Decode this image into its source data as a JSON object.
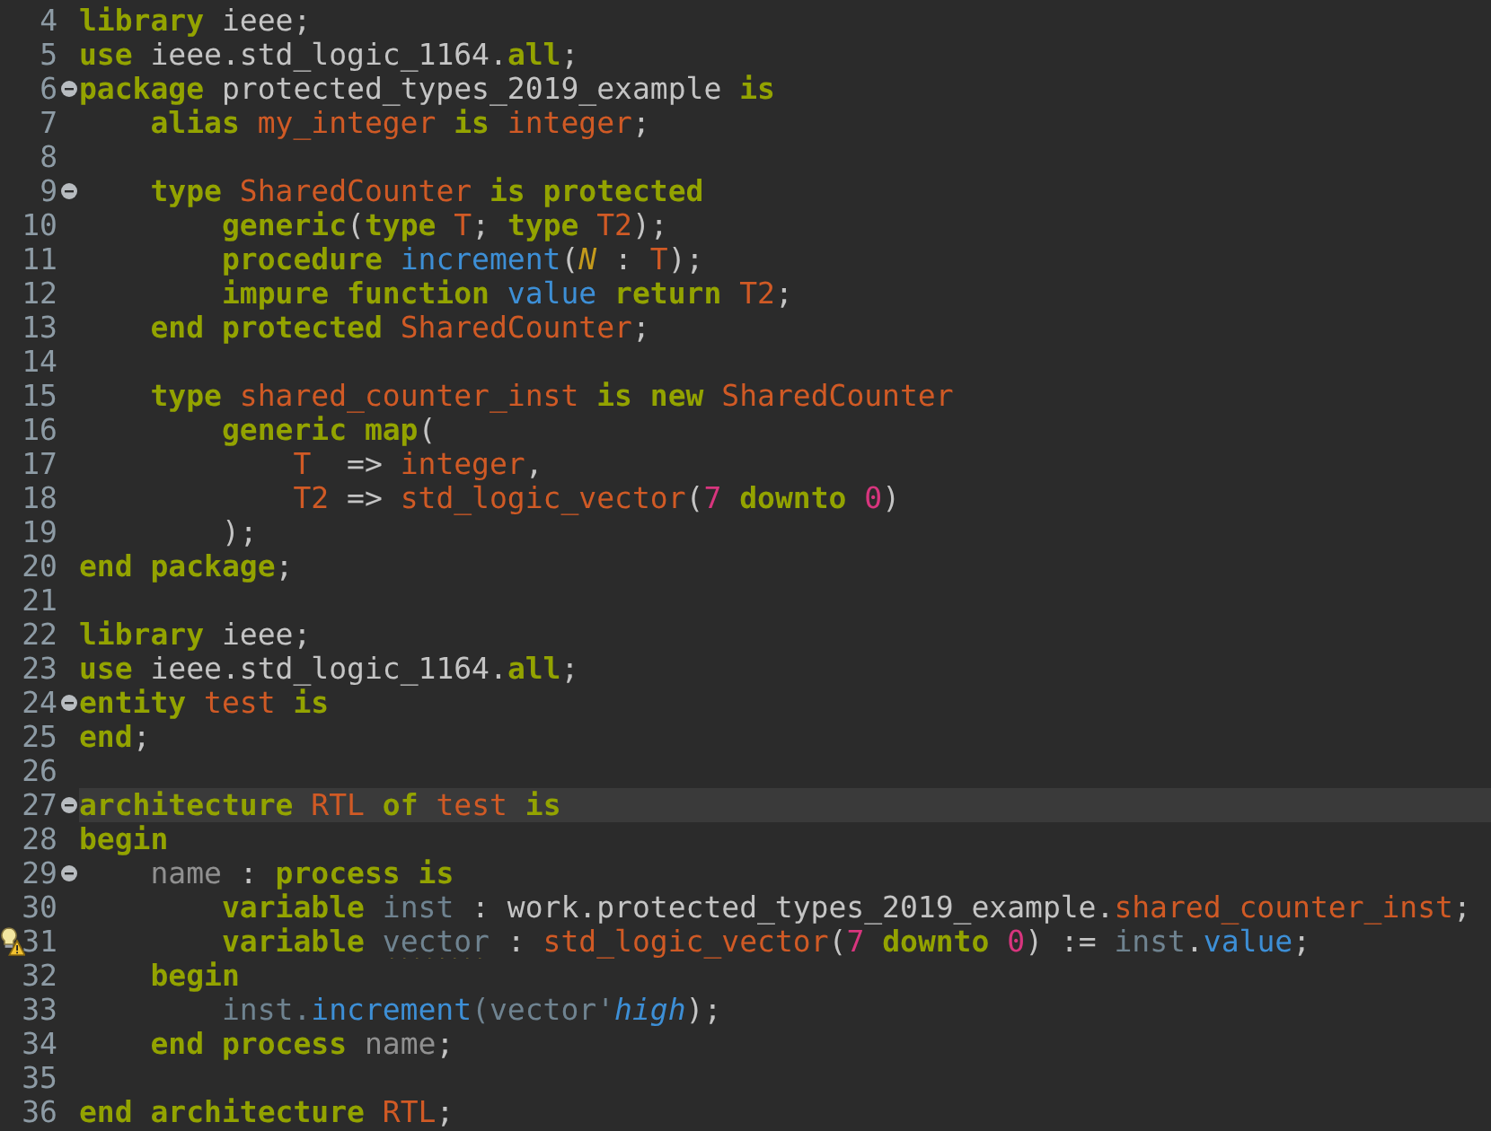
{
  "editor": {
    "lines": [
      {
        "number": "4",
        "fold": false,
        "current": false,
        "warning": false,
        "tokens": [
          {
            "kind": "kw",
            "text": "library"
          },
          {
            "kind": "txt",
            "text": " ieee;"
          }
        ]
      },
      {
        "number": "5",
        "fold": false,
        "current": false,
        "warning": false,
        "tokens": [
          {
            "kind": "kw",
            "text": "use"
          },
          {
            "kind": "txt",
            "text": " ieee.std_logic_1164."
          },
          {
            "kind": "kw",
            "text": "all"
          },
          {
            "kind": "txt",
            "text": ";"
          }
        ]
      },
      {
        "number": "6",
        "fold": true,
        "current": false,
        "warning": false,
        "tokens": [
          {
            "kind": "kw",
            "text": "package"
          },
          {
            "kind": "txt",
            "text": " protected_types_2019_example "
          },
          {
            "kind": "kw",
            "text": "is"
          }
        ]
      },
      {
        "number": "7",
        "fold": false,
        "current": false,
        "warning": false,
        "tokens": [
          {
            "kind": "kw",
            "text": "    alias"
          },
          {
            "kind": "id",
            "text": " my_integer"
          },
          {
            "kind": "kw",
            "text": " is"
          },
          {
            "kind": "id",
            "text": " integer"
          },
          {
            "kind": "txt",
            "text": ";"
          }
        ]
      },
      {
        "number": "8",
        "fold": false,
        "current": false,
        "warning": false
      },
      {
        "number": "9",
        "fold": true,
        "current": false,
        "warning": false,
        "tokens": [
          {
            "kind": "kw",
            "text": "    type"
          },
          {
            "kind": "id",
            "text": " SharedCounter"
          },
          {
            "kind": "kw",
            "text": " is protected"
          }
        ]
      },
      {
        "number": "10",
        "fold": false,
        "current": false,
        "warning": false,
        "tokens": [
          {
            "kind": "kw",
            "text": "        generic"
          },
          {
            "kind": "txt",
            "text": "("
          },
          {
            "kind": "kw",
            "text": "type"
          },
          {
            "kind": "id",
            "text": " T"
          },
          {
            "kind": "txt",
            "text": ";"
          },
          {
            "kind": "kw",
            "text": " type"
          },
          {
            "kind": "id",
            "text": " T2"
          },
          {
            "kind": "txt",
            "text": ");"
          }
        ]
      },
      {
        "number": "11",
        "fold": false,
        "current": false,
        "warning": false,
        "tokens": [
          {
            "kind": "kw",
            "text": "        procedure"
          },
          {
            "kind": "fn",
            "text": " increment"
          },
          {
            "kind": "txt",
            "text": "("
          },
          {
            "kind": "param",
            "text": "N"
          },
          {
            "kind": "txt",
            "text": " :"
          },
          {
            "kind": "id",
            "text": " T"
          },
          {
            "kind": "txt",
            "text": ");"
          }
        ]
      },
      {
        "number": "12",
        "fold": false,
        "current": false,
        "warning": false,
        "tokens": [
          {
            "kind": "kw",
            "text": "        impure function"
          },
          {
            "kind": "fn",
            "text": " value"
          },
          {
            "kind": "kw",
            "text": " return"
          },
          {
            "kind": "id",
            "text": " T2"
          },
          {
            "kind": "txt",
            "text": ";"
          }
        ]
      },
      {
        "number": "13",
        "fold": false,
        "current": false,
        "warning": false,
        "tokens": [
          {
            "kind": "kw",
            "text": "    end protected"
          },
          {
            "kind": "id",
            "text": " SharedCounter"
          },
          {
            "kind": "txt",
            "text": ";"
          }
        ]
      },
      {
        "number": "14",
        "fold": false,
        "current": false,
        "warning": false
      },
      {
        "number": "15",
        "fold": false,
        "current": false,
        "warning": false,
        "tokens": [
          {
            "kind": "kw",
            "text": "    type"
          },
          {
            "kind": "id",
            "text": " shared_counter_inst"
          },
          {
            "kind": "kw",
            "text": " is new"
          },
          {
            "kind": "id",
            "text": " SharedCounter"
          }
        ]
      },
      {
        "number": "16",
        "fold": false,
        "current": false,
        "warning": false,
        "tokens": [
          {
            "kind": "kw",
            "text": "        generic map"
          },
          {
            "kind": "txt",
            "text": "("
          }
        ]
      },
      {
        "number": "17",
        "fold": false,
        "current": false,
        "warning": false,
        "tokens": [
          {
            "kind": "id",
            "text": "            T"
          },
          {
            "kind": "txt",
            "text": "  =>"
          },
          {
            "kind": "id",
            "text": " integer"
          },
          {
            "kind": "txt",
            "text": ","
          }
        ]
      },
      {
        "number": "18",
        "fold": false,
        "current": false,
        "warning": false,
        "tokens": [
          {
            "kind": "id",
            "text": "            T2"
          },
          {
            "kind": "txt",
            "text": " =>"
          },
          {
            "kind": "id",
            "text": " std_logic_vector"
          },
          {
            "kind": "txt",
            "text": "("
          },
          {
            "kind": "num",
            "text": "7"
          },
          {
            "kind": "kw",
            "text": " downto"
          },
          {
            "kind": "num",
            "text": " 0"
          },
          {
            "kind": "txt",
            "text": ")"
          }
        ]
      },
      {
        "number": "19",
        "fold": false,
        "current": false,
        "warning": false,
        "tokens": [
          {
            "kind": "txt",
            "text": "        );"
          }
        ]
      },
      {
        "number": "20",
        "fold": false,
        "current": false,
        "warning": false,
        "tokens": [
          {
            "kind": "kw",
            "text": "end package"
          },
          {
            "kind": "txt",
            "text": ";"
          }
        ]
      },
      {
        "number": "21",
        "fold": false,
        "current": false,
        "warning": false
      },
      {
        "number": "22",
        "fold": false,
        "current": false,
        "warning": false,
        "tokens": [
          {
            "kind": "kw",
            "text": "library"
          },
          {
            "kind": "txt",
            "text": " ieee;"
          }
        ]
      },
      {
        "number": "23",
        "fold": false,
        "current": false,
        "warning": false,
        "tokens": [
          {
            "kind": "kw",
            "text": "use"
          },
          {
            "kind": "txt",
            "text": " ieee.std_logic_1164."
          },
          {
            "kind": "kw",
            "text": "all"
          },
          {
            "kind": "txt",
            "text": ";"
          }
        ]
      },
      {
        "number": "24",
        "fold": true,
        "current": false,
        "warning": false,
        "tokens": [
          {
            "kind": "kw",
            "text": "entity"
          },
          {
            "kind": "id",
            "text": " test"
          },
          {
            "kind": "kw",
            "text": " is"
          }
        ]
      },
      {
        "number": "25",
        "fold": false,
        "current": false,
        "warning": false,
        "tokens": [
          {
            "kind": "kw",
            "text": "end"
          },
          {
            "kind": "txt",
            "text": ";"
          }
        ]
      },
      {
        "number": "26",
        "fold": false,
        "current": false,
        "warning": false
      },
      {
        "number": "27",
        "fold": true,
        "current": true,
        "warning": false,
        "tokens": [
          {
            "kind": "kw",
            "text": "architecture"
          },
          {
            "kind": "id",
            "text": " RTL"
          },
          {
            "kind": "kw",
            "text": " of"
          },
          {
            "kind": "id",
            "text": " test"
          },
          {
            "kind": "kw",
            "text": " is"
          }
        ]
      },
      {
        "number": "28",
        "fold": false,
        "current": false,
        "warning": false,
        "tokens": [
          {
            "kind": "kw",
            "text": "begin"
          }
        ]
      },
      {
        "number": "29",
        "fold": true,
        "current": false,
        "warning": false,
        "tokens": [
          {
            "kind": "label",
            "text": "    name"
          },
          {
            "kind": "txt",
            "text": " :"
          },
          {
            "kind": "kw",
            "text": " process is"
          }
        ]
      },
      {
        "number": "30",
        "fold": false,
        "current": false,
        "warning": false,
        "tokens": [
          {
            "kind": "kw",
            "text": "        variable"
          },
          {
            "kind": "var",
            "text": " inst"
          },
          {
            "kind": "txt",
            "text": " : work.protected_types_2019_example."
          },
          {
            "kind": "id",
            "text": "shared_counter_inst"
          },
          {
            "kind": "txt",
            "text": ";"
          }
        ]
      },
      {
        "number": "31",
        "fold": false,
        "current": false,
        "warning": true,
        "tokens": [
          {
            "kind": "kw",
            "text": "        variable "
          },
          {
            "kind": "warn",
            "text": "vector"
          },
          {
            "kind": "txt",
            "text": " :"
          },
          {
            "kind": "id",
            "text": " std_logic_vector"
          },
          {
            "kind": "txt",
            "text": "("
          },
          {
            "kind": "num",
            "text": "7"
          },
          {
            "kind": "kw",
            "text": " downto"
          },
          {
            "kind": "num",
            "text": " 0"
          },
          {
            "kind": "txt",
            "text": ") :="
          },
          {
            "kind": "var",
            "text": " inst"
          },
          {
            "kind": "txt",
            "text": "."
          },
          {
            "kind": "fn",
            "text": "value"
          },
          {
            "kind": "txt",
            "text": ";"
          }
        ]
      },
      {
        "number": "32",
        "fold": false,
        "current": false,
        "warning": false,
        "tokens": [
          {
            "kind": "kw",
            "text": "    begin"
          }
        ]
      },
      {
        "number": "33",
        "fold": false,
        "current": false,
        "warning": false,
        "tokens": [
          {
            "kind": "var",
            "text": "        inst."
          },
          {
            "kind": "fn",
            "text": "increment"
          },
          {
            "kind": "var",
            "text": "(vector'"
          },
          {
            "kind": "attr",
            "text": "high"
          },
          {
            "kind": "txt",
            "text": ");"
          }
        ]
      },
      {
        "number": "34",
        "fold": false,
        "current": false,
        "warning": false,
        "tokens": [
          {
            "kind": "kw",
            "text": "    end process"
          },
          {
            "kind": "label",
            "text": " name"
          },
          {
            "kind": "txt",
            "text": ";"
          }
        ]
      },
      {
        "number": "35",
        "fold": false,
        "current": false,
        "warning": false
      },
      {
        "number": "36",
        "fold": false,
        "current": false,
        "warning": false,
        "tokens": [
          {
            "kind": "kw",
            "text": "end architecture"
          },
          {
            "kind": "id",
            "text": " RTL"
          },
          {
            "kind": "txt",
            "text": ";"
          }
        ]
      }
    ]
  }
}
